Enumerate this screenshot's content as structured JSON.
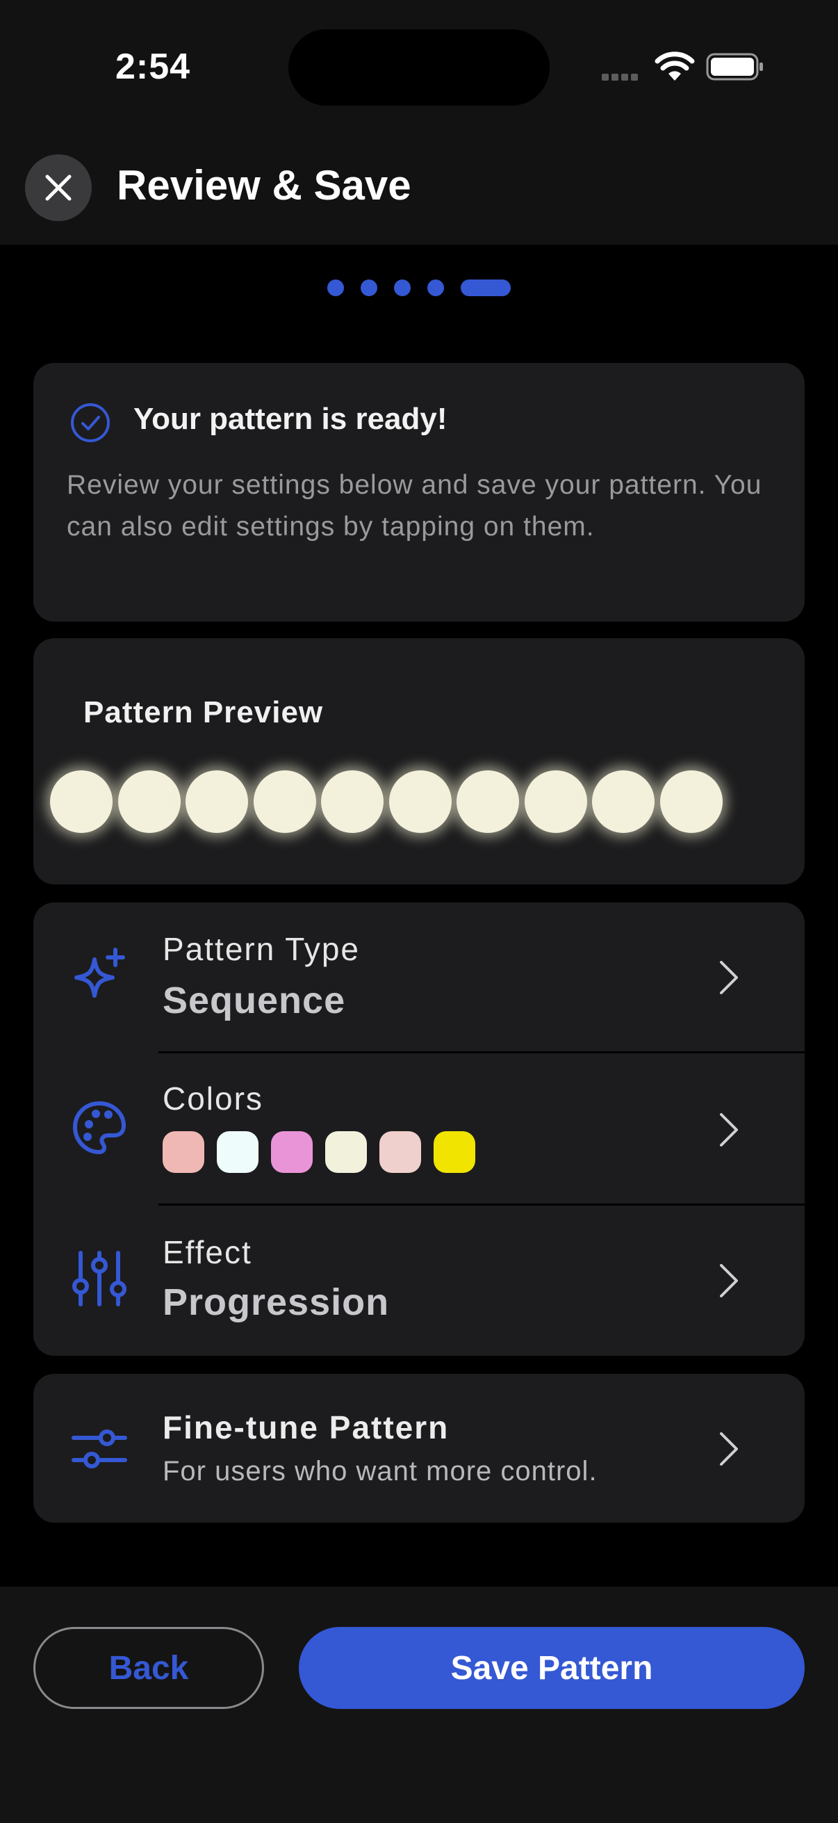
{
  "status_bar": {
    "time": "2:54"
  },
  "header": {
    "title": "Review & Save"
  },
  "steps": {
    "total": 5,
    "current": 5
  },
  "ready_card": {
    "title": "Your pattern is ready!",
    "body": "Review your settings below and save your pattern. You can also edit settings by tapping on them."
  },
  "preview": {
    "title": "Pattern Preview",
    "bulb_count": 10,
    "bulb_color": "#f3f1dc"
  },
  "settings": {
    "pattern_type": {
      "label": "Pattern Type",
      "value": "Sequence",
      "icon": "sparkles-icon"
    },
    "colors": {
      "label": "Colors",
      "icon": "palette-icon",
      "swatches": [
        "#f0b8b4",
        "#effcfc",
        "#ea94d8",
        "#f2f2dc",
        "#f0d0cc",
        "#f0e400"
      ]
    },
    "effect": {
      "label": "Effect",
      "value": "Progression",
      "icon": "sliders-vertical-icon"
    }
  },
  "fine_tune": {
    "title": "Fine-tune Pattern",
    "subtitle": "For users who want more control.",
    "icon": "sliders-horizontal-icon"
  },
  "footer": {
    "back_label": "Back",
    "save_label": "Save Pattern"
  },
  "colors": {
    "accent": "#3558d4",
    "card": "#1c1c1e",
    "background": "#000000"
  }
}
